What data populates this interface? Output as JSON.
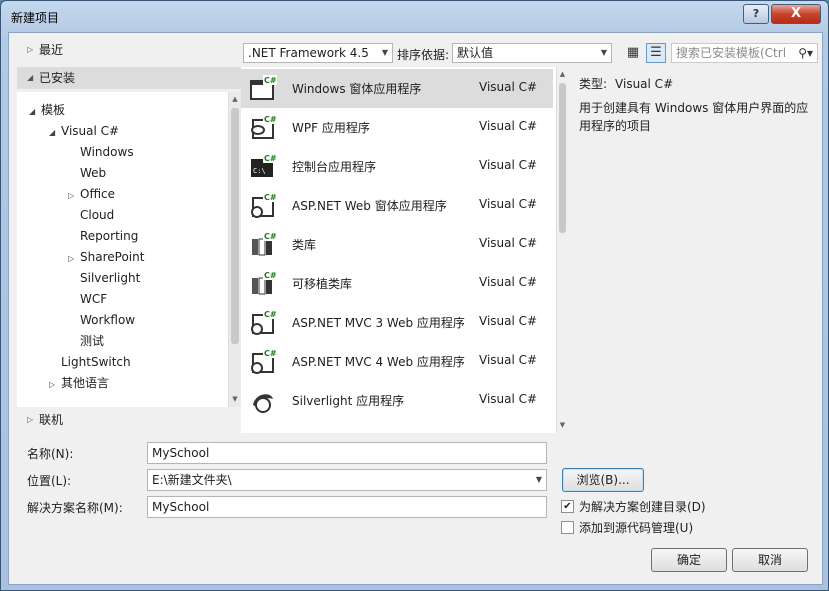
{
  "window": {
    "title": "新建项目",
    "help_label": "?",
    "close_label": "X"
  },
  "left": {
    "recent": "最近",
    "installed": "已安装",
    "online": "联机",
    "tree": [
      {
        "label": "模板"
      },
      {
        "label": "Visual C#"
      },
      {
        "label": "Windows"
      },
      {
        "label": "Web"
      },
      {
        "label": "Office"
      },
      {
        "label": "Cloud"
      },
      {
        "label": "Reporting"
      },
      {
        "label": "SharePoint"
      },
      {
        "label": "Silverlight"
      },
      {
        "label": "WCF"
      },
      {
        "label": "Workflow"
      },
      {
        "label": "测试"
      },
      {
        "label": "LightSwitch"
      },
      {
        "label": "其他语言"
      }
    ]
  },
  "toolbar": {
    "framework": ".NET Framework 4.5",
    "sort_label": "排序依据:",
    "sort_value": "默认值",
    "search_placeholder": "搜索已安装模板(Ctrl"
  },
  "templates": [
    {
      "name": "Windows 窗体应用程序",
      "lang": "Visual C#",
      "icon": "windows-form-icon"
    },
    {
      "name": "WPF 应用程序",
      "lang": "Visual C#",
      "icon": "wpf-icon"
    },
    {
      "name": "控制台应用程序",
      "lang": "Visual C#",
      "icon": "console-icon"
    },
    {
      "name": "ASP.NET Web 窗体应用程序",
      "lang": "Visual C#",
      "icon": "web-form-icon"
    },
    {
      "name": "类库",
      "lang": "Visual C#",
      "icon": "class-library-icon"
    },
    {
      "name": "可移植类库",
      "lang": "Visual C#",
      "icon": "portable-library-icon"
    },
    {
      "name": "ASP.NET MVC 3 Web 应用程序",
      "lang": "Visual C#",
      "icon": "mvc3-icon"
    },
    {
      "name": "ASP.NET MVC 4 Web 应用程序",
      "lang": "Visual C#",
      "icon": "mvc4-icon"
    },
    {
      "name": "Silverlight 应用程序",
      "lang": "Visual C#",
      "icon": "silverlight-icon"
    }
  ],
  "description": {
    "type_label": "类型:",
    "type_value": "Visual C#",
    "text": "用于创建具有 Windows 窗体用户界面的应用程序的项目"
  },
  "form": {
    "name_label": "名称(N):",
    "name_value": "MySchool",
    "location_label": "位置(L):",
    "location_value": "E:\\新建文件夹\\",
    "solution_label": "解决方案名称(M):",
    "solution_value": "MySchool",
    "browse": "浏览(B)...",
    "create_dir": "为解决方案创建目录(D)",
    "create_dir_checked": true,
    "add_source": "添加到源代码管理(U)",
    "add_source_checked": false,
    "ok": "确定",
    "cancel": "取消"
  },
  "colors": {
    "accent": "#3c7fb1",
    "selection": "#dcdcdc"
  }
}
